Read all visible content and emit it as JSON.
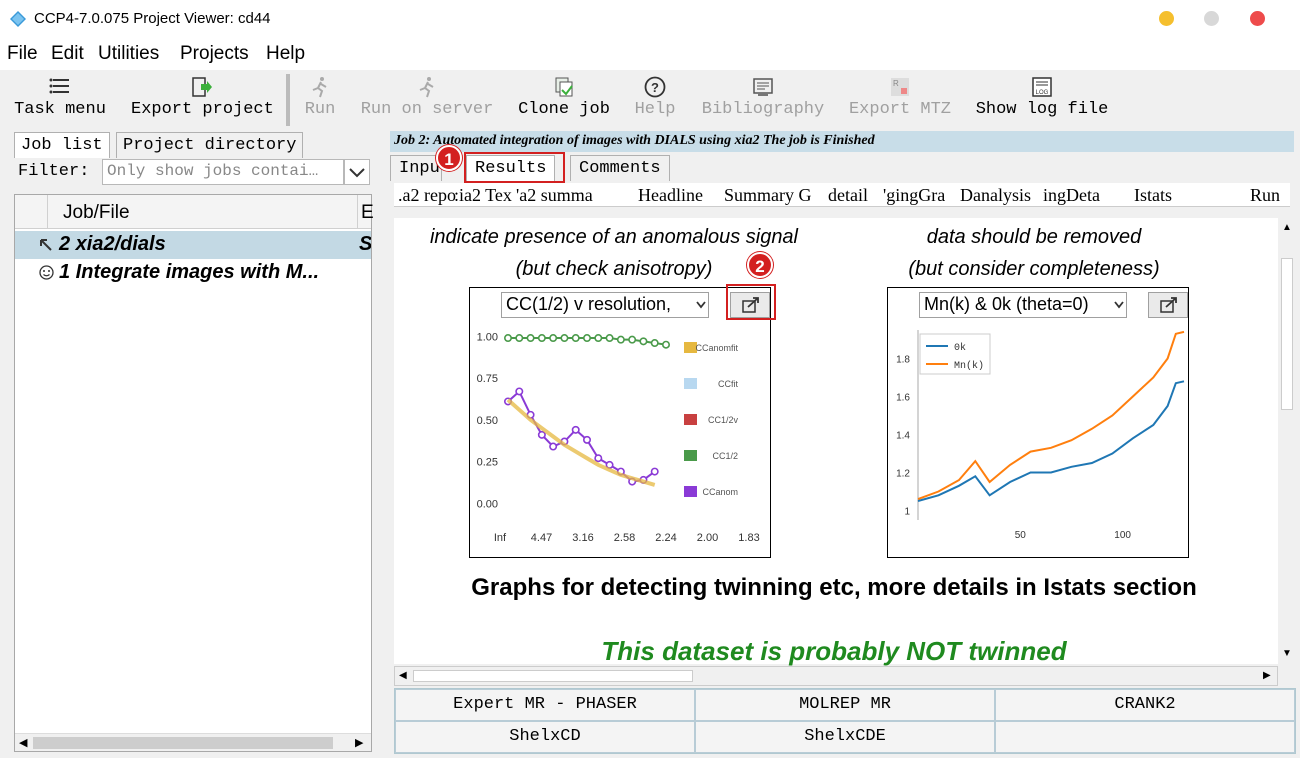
{
  "window": {
    "title": "CCP4-7.0.075 Project Viewer: cd44"
  },
  "menu": [
    "File",
    "Edit",
    "Utilities",
    "Projects",
    "Help"
  ],
  "toolbar": [
    {
      "label": "Task menu",
      "icon": "task-menu-icon",
      "enabled": true
    },
    {
      "label": "Export project",
      "icon": "export-project-icon",
      "enabled": true
    },
    {
      "label": "Run",
      "icon": "run-icon",
      "enabled": false
    },
    {
      "label": "Run on server",
      "icon": "run-server-icon",
      "enabled": false
    },
    {
      "label": "Clone job",
      "icon": "clone-icon",
      "enabled": true
    },
    {
      "label": "Help",
      "icon": "help-icon",
      "enabled": false
    },
    {
      "label": "Bibliography",
      "icon": "bibliography-icon",
      "enabled": false
    },
    {
      "label": "Export MTZ",
      "icon": "export-mtz-icon",
      "enabled": false
    },
    {
      "label": "Show log file",
      "icon": "log-file-icon",
      "enabled": true
    }
  ],
  "left": {
    "tabs": [
      "Job list",
      "Project directory"
    ],
    "filter_label": "Filter:",
    "filter_placeholder": "Only show jobs contai…",
    "column_header": "Job/File",
    "column_header2": "E",
    "jobs": [
      {
        "label": "2 xia2/dials",
        "tail": "S",
        "selected": true,
        "icon": "arrow-icon"
      },
      {
        "label": "1 Integrate images with M...",
        "tail": "",
        "selected": false,
        "icon": "smiley-icon"
      }
    ]
  },
  "right": {
    "banner": "Job 2:  Automated integration of images with DIALS using xia2 The job is Finished",
    "tabs": [
      "Input",
      "Results",
      "Comments"
    ],
    "subtabs": [
      ".a2 repo",
      ":ia2 Tex",
      "'a2 summa",
      "Headline",
      "Summary G",
      "detail",
      "'gingGra",
      "Danalysis",
      "ingDeta",
      "Istats",
      "Run"
    ],
    "captions": {
      "left_line1": "indicate presence of an anomalous signal",
      "left_line2": "(but check anisotropy)",
      "right_line1": "data should be removed",
      "right_line2": "(but consider completeness)"
    },
    "graph1": {
      "select": "CC(1/2) v resolution,"
    },
    "graph2": {
      "select": "Mn(k) & 0k (theta=0)"
    },
    "section_heading": "Graphs for detecting twinning etc, more details in Istats section",
    "section_result": "This dataset is probably NOT twinned",
    "badges": [
      "1",
      "2"
    ],
    "bottom_buttons": [
      "Expert MR - PHASER",
      "MOLREP MR",
      "CRANK2",
      "ShelxCD",
      "ShelxCDE",
      ""
    ]
  },
  "chart_data": [
    {
      "type": "line",
      "title": "CC(1/2) v resolution",
      "x_ticks": [
        "Inf",
        "4.47",
        "3.16",
        "2.58",
        "2.24",
        "2.00",
        "1.83"
      ],
      "y_ticks": [
        "1.00",
        "0.75",
        "0.50",
        "0.25",
        "0.00"
      ],
      "ylim": [
        -0.1,
        1.05
      ],
      "legend_position": "right",
      "series": [
        {
          "name": "CC1/2",
          "color": "#4a9a4a",
          "values": [
            0.99,
            0.99,
            0.99,
            0.99,
            0.99,
            0.99,
            0.99,
            0.99,
            0.99,
            0.99,
            0.98,
            0.98,
            0.97,
            0.96,
            0.95
          ]
        },
        {
          "name": "CCanom",
          "color": "#8a3ad6",
          "values": [
            0.61,
            0.67,
            0.53,
            0.41,
            0.34,
            0.37,
            0.44,
            0.38,
            0.27,
            0.23,
            0.19,
            0.13,
            0.14,
            0.19
          ]
        },
        {
          "name": "CCanomfit",
          "color": "#e6b840",
          "values": [
            0.62,
            0.56,
            0.5,
            0.45,
            0.4,
            0.35,
            0.31,
            0.27,
            0.23,
            0.2,
            0.17,
            0.15,
            0.13,
            0.11
          ]
        },
        {
          "name": "CCfit",
          "color": "#b8d8f0",
          "values": []
        },
        {
          "name": "CC1/2v",
          "color": "#c84040",
          "values": []
        }
      ]
    },
    {
      "type": "line",
      "title": "Mn(k) & 0k (theta=0)",
      "x_ticks": [
        "50",
        "100"
      ],
      "y_ticks": [
        "1.8",
        "1.6",
        "1.4",
        "1.2",
        "1"
      ],
      "ylim": [
        0.95,
        1.95
      ],
      "xlim": [
        0,
        130
      ],
      "legend_position": "top-left",
      "series": [
        {
          "name": "0k",
          "color": "#1f77b4",
          "x": [
            0,
            10,
            20,
            28,
            35,
            45,
            55,
            65,
            75,
            85,
            95,
            105,
            115,
            122,
            126,
            130
          ],
          "values": [
            1.05,
            1.08,
            1.13,
            1.18,
            1.08,
            1.15,
            1.2,
            1.2,
            1.23,
            1.25,
            1.3,
            1.38,
            1.45,
            1.55,
            1.67,
            1.68
          ]
        },
        {
          "name": "Mn(k)",
          "color": "#ff7f0e",
          "x": [
            0,
            10,
            20,
            28,
            35,
            45,
            55,
            65,
            75,
            85,
            95,
            105,
            115,
            122,
            126,
            130
          ],
          "values": [
            1.06,
            1.1,
            1.16,
            1.26,
            1.15,
            1.24,
            1.31,
            1.33,
            1.37,
            1.43,
            1.5,
            1.6,
            1.7,
            1.8,
            1.93,
            1.94
          ]
        }
      ]
    }
  ]
}
